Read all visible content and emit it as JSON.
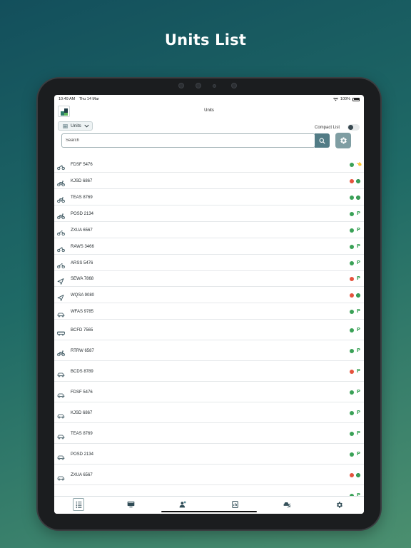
{
  "headline": "Units List",
  "status_bar": {
    "time": "10:49 AM",
    "date": "Thu 14 Mar",
    "battery": "100%"
  },
  "header": {
    "title": "Units"
  },
  "toolbar": {
    "units_label": "Units",
    "compact_label": "Compact List"
  },
  "search": {
    "placeholder": "Search"
  },
  "colors": {
    "green": "#3aa157",
    "red": "#e5533d",
    "accent": "#527c86"
  },
  "units": [
    {
      "name": "FDSF 5476",
      "icon": "motorcycle-icon",
      "dot": "green",
      "status": "hand"
    },
    {
      "name": "KJSD 6867",
      "icon": "bicycle-icon",
      "dot": "red",
      "status": "circle"
    },
    {
      "name": "TEAS 8769",
      "icon": "bicycle-icon",
      "dot": "green",
      "status": "circle"
    },
    {
      "name": "POSD 2134",
      "icon": "bicycle-icon",
      "dot": "green",
      "status": "P"
    },
    {
      "name": "ZXUA 6567",
      "icon": "motorcycle-icon",
      "dot": "green",
      "status": "P"
    },
    {
      "name": "RAWS 3466",
      "icon": "motorcycle-icon",
      "dot": "green",
      "status": "P"
    },
    {
      "name": "ARSS 5476",
      "icon": "motorcycle-icon",
      "dot": "green",
      "status": "P"
    },
    {
      "name": "SEWA 7868",
      "icon": "navigation-icon",
      "dot": "red",
      "status": "P"
    },
    {
      "name": "WQSA 9080",
      "icon": "navigation-icon",
      "dot": "red",
      "status": "circle"
    },
    {
      "name": "WFAS 9785",
      "icon": "car-icon",
      "dot": "green",
      "status": "P"
    },
    {
      "name": "BCFD 7565",
      "icon": "bus-icon",
      "dot": "green",
      "status": "P"
    },
    {
      "name": "RTRW 6587",
      "icon": "bicycle-icon",
      "dot": "green",
      "status": "P"
    },
    {
      "name": "BCDS 8789",
      "icon": "car-icon",
      "dot": "red",
      "status": "P"
    },
    {
      "name": "FDSF 5476",
      "icon": "car-icon",
      "dot": "green",
      "status": "P"
    },
    {
      "name": "KJSD 6867",
      "icon": "car-icon",
      "dot": "green",
      "status": "P"
    },
    {
      "name": "TEAS 8769",
      "icon": "car-icon",
      "dot": "green",
      "status": "P"
    },
    {
      "name": "POSD 2134",
      "icon": "car-icon",
      "dot": "green",
      "status": "P"
    },
    {
      "name": "ZXUA 6567",
      "icon": "car-icon",
      "dot": "red",
      "status": "circle"
    },
    {
      "name": "",
      "icon": "car-icon",
      "dot": "green",
      "status": "P"
    }
  ],
  "tabs": [
    {
      "icon": "list-icon",
      "active": true
    },
    {
      "icon": "monitor-icon",
      "active": false
    },
    {
      "icon": "alert-user-icon",
      "active": false
    },
    {
      "icon": "report-icon",
      "active": false
    },
    {
      "icon": "fleet-icon",
      "active": false
    },
    {
      "icon": "gear-icon",
      "active": false
    }
  ]
}
